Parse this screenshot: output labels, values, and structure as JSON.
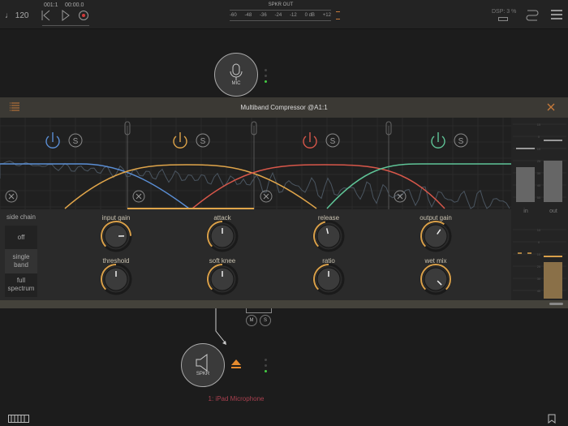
{
  "topbar": {
    "tempo": "♩ 120",
    "position": "001:1",
    "time": "00:00.0",
    "meter_title": "SPKR OUT",
    "meter_ticks": [
      "-60",
      "-48",
      "-36",
      "-24",
      "-12",
      "0 dB",
      "+12"
    ],
    "dsp": "DSP: 3 %"
  },
  "nodes": {
    "mic_label": "MIC",
    "spkr_label": "SPKR",
    "input_name": "1: iPad Microphone",
    "mute": "M",
    "solo": "S"
  },
  "plugin": {
    "title": "Multiband Compressor @A1:1",
    "bands": [
      {
        "color": "#5b8fd6",
        "solo": "S"
      },
      {
        "color": "#e0a54a",
        "solo": "S"
      },
      {
        "color": "#d8574a",
        "solo": "S"
      },
      {
        "color": "#5fc497",
        "solo": "S"
      }
    ],
    "side_chain": {
      "label": "side chain",
      "options": [
        "off",
        "single band",
        "full spectrum"
      ],
      "selected": 1
    },
    "knobs": [
      {
        "label": "input gain",
        "value": 0.83
      },
      {
        "label": "attack",
        "value": 0.5
      },
      {
        "label": "release",
        "value": 0.45
      },
      {
        "label": "output gain",
        "value": 0.63
      },
      {
        "label": "threshold",
        "value": 0.5
      },
      {
        "label": "soft knee",
        "value": 0.5
      },
      {
        "label": "ratio",
        "value": 0.5
      },
      {
        "label": "wet mix",
        "value": 1.0
      }
    ],
    "meters": {
      "in_label": "in",
      "out_label": "out",
      "scale": [
        "10",
        "0",
        "10",
        "20",
        "30",
        "40",
        "50"
      ]
    }
  },
  "colors": {
    "accent": "#e0a54a",
    "record": "#d23a3a",
    "input_name": "#a8404f"
  }
}
